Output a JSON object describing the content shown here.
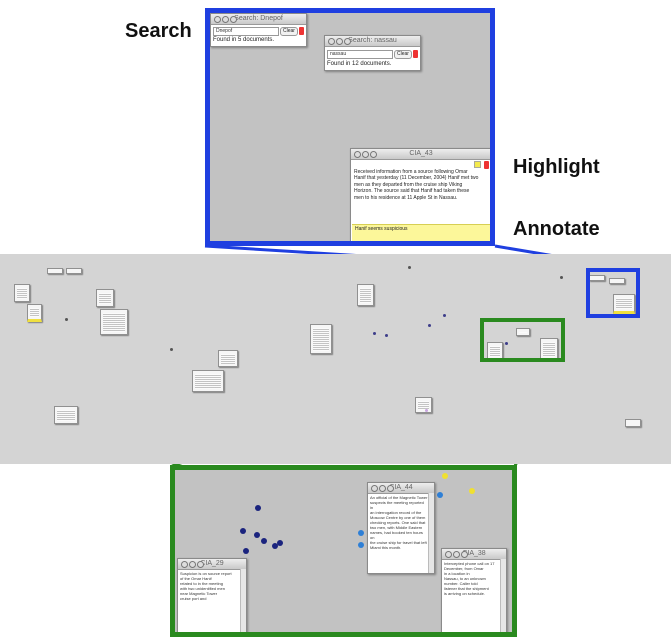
{
  "labels": {
    "search": "Search",
    "highlight": "Highlight",
    "annotate": "Annotate"
  },
  "search_window_1": {
    "title": "Search: Dnepof",
    "query": "Dnepof",
    "clear_label": "Clear",
    "result": "Found in 5 documents."
  },
  "search_window_2": {
    "title": "Search: nassau",
    "query": "nassau",
    "clear_label": "Clear",
    "result": "Found in 12 documents."
  },
  "document_window": {
    "title": "CIA_43",
    "body_lines": [
      "Received information from a source following Omar",
      "Hanif that yesterday (11 December, 2004) Hanif met two",
      "men as they departed from the cruise ship Viking",
      "Horizon. The source said that Hanif had taken these",
      "men to his residence at 11 Apple St in Nassau."
    ],
    "note": "Hanif seems suspicious"
  },
  "green_windows": [
    {
      "title": "CIA_44",
      "lines": [
        "An official of the Magnetic Tower",
        "suspects the meeting reported in",
        "an interrogation record of the",
        "Moscow Centre by one of them",
        "checking reports. One said that",
        "two men, with Middle Eastern",
        "names, had booked ten hours on",
        "the cruise ship for travel that left",
        "Miami this month."
      ]
    },
    {
      "title": "CIA_38",
      "lines": [
        "Intercepted phone call on 17",
        "December, from Omar",
        "in a location in",
        "Nassau, to an unknown",
        "number. Caller told",
        "listener that the shipment",
        "is arriving on schedule."
      ]
    },
    {
      "title": "CIA_29",
      "lines": [
        "Suspicion is on source report",
        "of the Omar Hanif",
        "related to in the meeting",
        "with two unidentified men",
        "near Magnetic Tower",
        "cruise port and"
      ]
    }
  ],
  "colors": {
    "blue_frame": "#1f3fe0",
    "green_frame": "#2a8a1f",
    "highlight": "#f4ea4c",
    "node_dark": "#1a237e",
    "node_blue": "#2e7fd6",
    "node_yellow": "#f0e030"
  }
}
